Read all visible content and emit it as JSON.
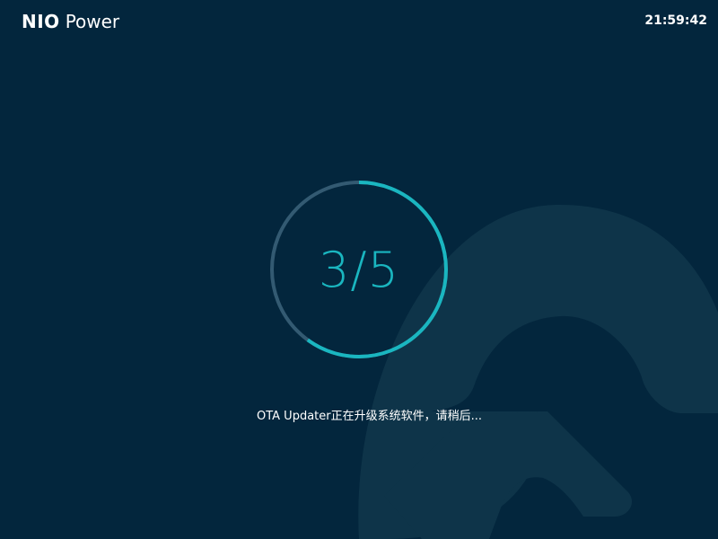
{
  "header": {
    "brand_name": "NIO",
    "brand_sub": "Power",
    "clock": "21:59:42"
  },
  "progress": {
    "current": 3,
    "total": 5,
    "label": "3/5"
  },
  "status": {
    "message": "OTA Updater正在升级系统软件，请稍后..."
  },
  "colors": {
    "background": "#03263d",
    "accent": "#1ab6c0",
    "track": "#335a72",
    "watermark": "#0e3449"
  },
  "icons": {
    "background": "nio-logo-watermark"
  }
}
